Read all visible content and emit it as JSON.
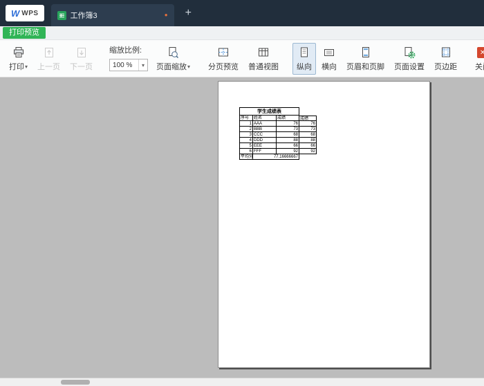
{
  "titlebar": {
    "wps_logo_w": "W",
    "wps_logo_text": "WPS",
    "tab_label": "工作簿3",
    "new_tab": "+"
  },
  "banner": {
    "preview_label": "打印预览"
  },
  "toolbar": {
    "print": "打印",
    "prev_page": "上一页",
    "next_page": "下一页",
    "zoom_ratio_label": "缩放比例:",
    "zoom_value": "100 %",
    "page_zoom": "页面缩放",
    "pagebreak_preview": "分页预览",
    "normal_view": "普通视图",
    "portrait": "纵向",
    "landscape": "横向",
    "header_footer": "页眉和页脚",
    "page_setup": "页面设置",
    "margins": "页边距",
    "close": "关闭"
  },
  "icons": {
    "dropdown_arrow": "▾",
    "close_x": "✕",
    "modified_dot": "●"
  },
  "sheet": {
    "title": "学生成绩表",
    "headers": [
      "序号",
      "姓名",
      "成绩",
      "成绩"
    ],
    "rows": [
      [
        "1",
        "AAA",
        "76",
        "76"
      ],
      [
        "2",
        "BBB",
        "73",
        "73"
      ],
      [
        "3",
        "CCC",
        "68",
        "68"
      ],
      [
        "4",
        "DDD",
        "88",
        "88"
      ],
      [
        "5",
        "EEE",
        "66",
        "66"
      ],
      [
        "6",
        "FFF",
        "92",
        "92"
      ]
    ],
    "summary_label": "平均分",
    "summary_value": "77.16666667"
  }
}
